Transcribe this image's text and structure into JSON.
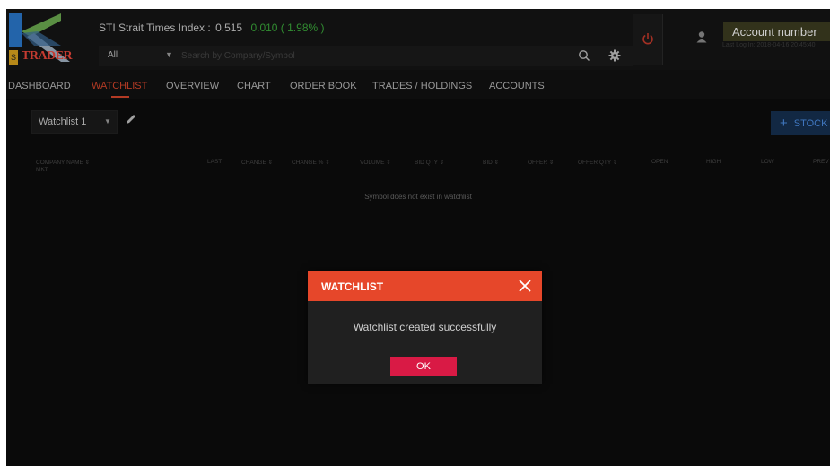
{
  "header": {
    "logo_text": "TRADER",
    "logo_badge": "S",
    "index": {
      "label": "STI Strait Times Index :",
      "value": "0.515",
      "change": "0.010 ( 1.98% )",
      "change_color": "#3aa53a"
    },
    "market_select": "All",
    "search_placeholder": "Search by Company/Symbol",
    "account_number_label": "Account number",
    "last_log": "Last Log In: 2018-04-16 20:45:40"
  },
  "nav": {
    "items": [
      {
        "label": "DASHBOARD",
        "active": false
      },
      {
        "label": "WATCHLIST",
        "active": true
      },
      {
        "label": "OVERVIEW",
        "active": false
      },
      {
        "label": "CHART",
        "active": false
      },
      {
        "label": "ORDER BOOK",
        "active": false
      },
      {
        "label": "TRADES / HOLDINGS",
        "active": false
      },
      {
        "label": "ACCOUNTS",
        "active": false
      }
    ],
    "active_color": "#d3452b"
  },
  "watchlist": {
    "selected": "Watchlist 1",
    "add_stock_label": "STOCK",
    "columns": [
      "COMPANY NAME",
      "MKT",
      "LAST",
      "CHANGE",
      "CHANGE %",
      "VOLUME",
      "BID QTY",
      "BID",
      "OFFER",
      "OFFER QTY",
      "OPEN",
      "HIGH",
      "LOW",
      "PREV"
    ],
    "empty_message": "Symbol does not exist in watchlist"
  },
  "modal": {
    "title": "WATCHLIST",
    "message": "Watchlist created successfully",
    "ok_label": "OK",
    "header_color": "#e6472a",
    "ok_color": "#d91a45"
  },
  "icons": {
    "search": "search-icon",
    "settings": "gear-icon",
    "power": "power-icon",
    "user": "user-icon",
    "edit": "pencil-icon",
    "close": "close-icon",
    "sort": "sort-icon"
  }
}
